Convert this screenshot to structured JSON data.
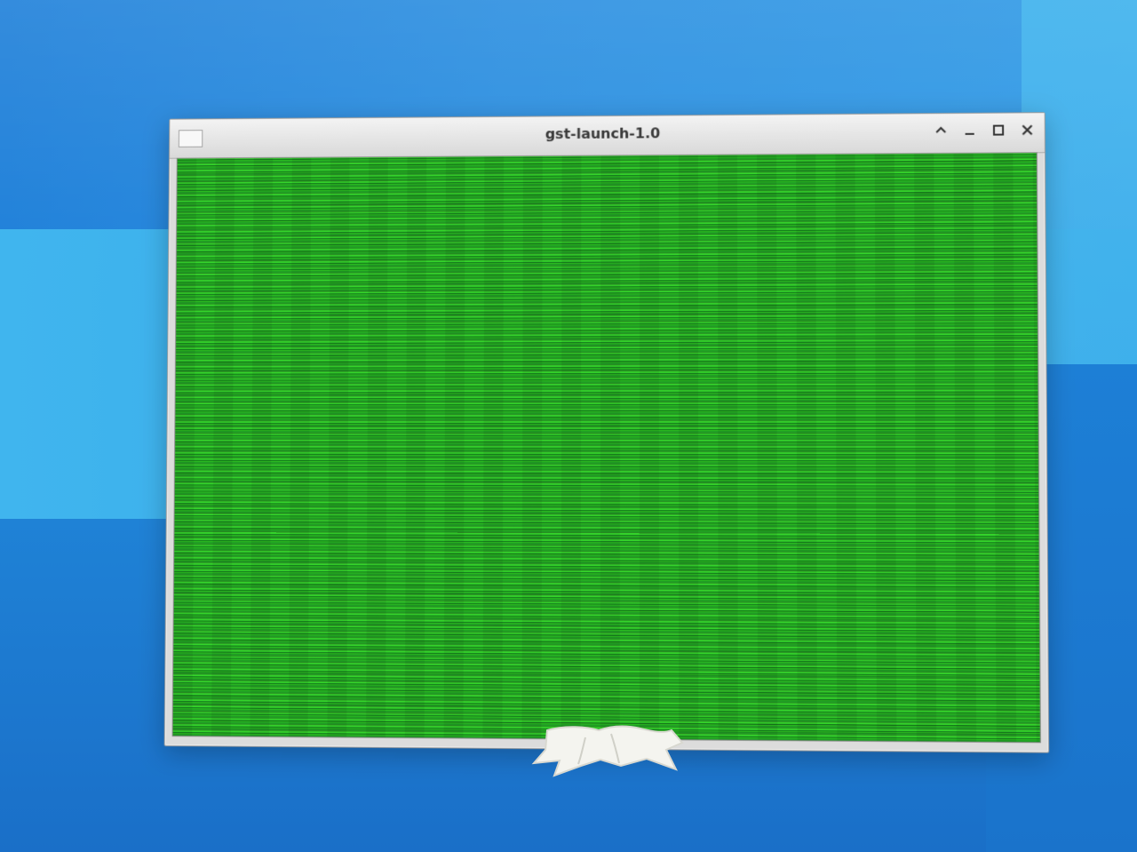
{
  "desktop": {
    "background": {
      "primary_blue": "#1d7fd9",
      "light_blue": "#42b8ef",
      "deep_blue": "#1a6fc8"
    }
  },
  "window": {
    "title": "gst-launch-1.0",
    "controls": {
      "shade_icon": "chevron-up-icon",
      "minimize_icon": "minimize-icon",
      "maximize_icon": "maximize-icon",
      "close_icon": "close-icon"
    },
    "content": {
      "type": "video-output",
      "dominant_color": "#2ec51f"
    }
  },
  "bottom_artifact": {
    "color": "#f4f4ef"
  }
}
